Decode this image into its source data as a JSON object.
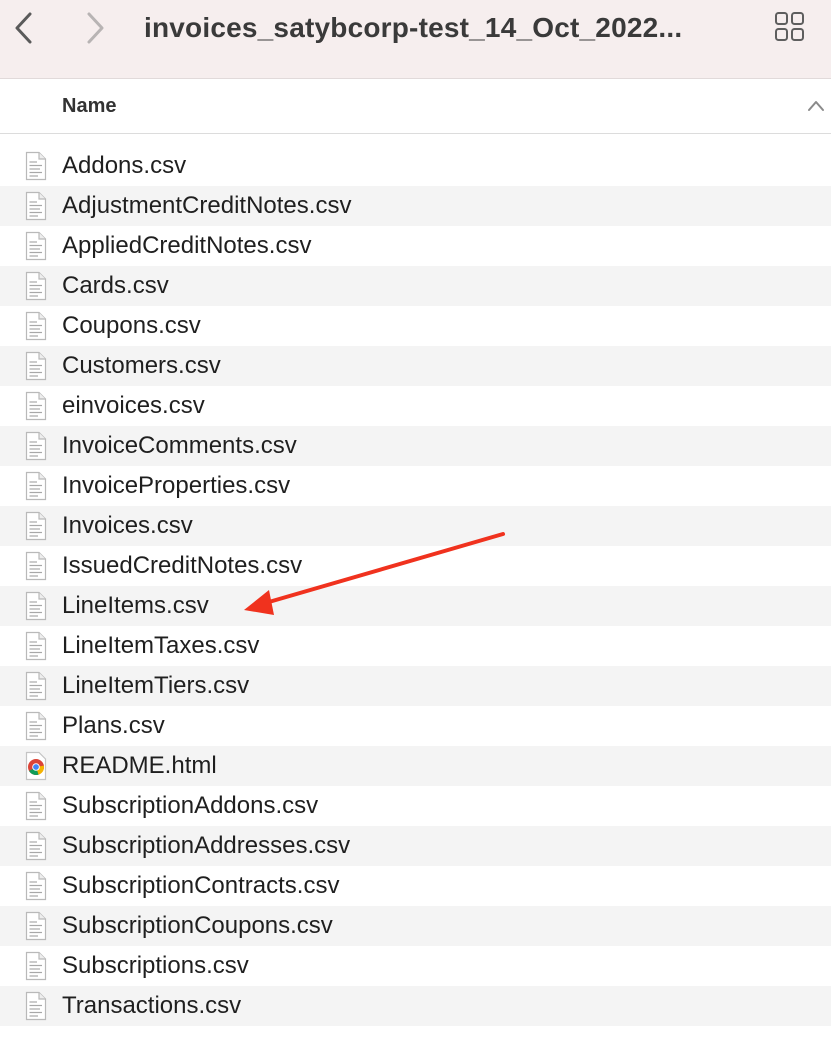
{
  "toolbar": {
    "title": "invoices_satybcorp-test_14_Oct_2022...",
    "back_icon": "chevron-left-icon",
    "forward_icon": "chevron-right-icon",
    "view_icon": "grid-view-icon"
  },
  "columns": {
    "name_label": "Name",
    "sort_icon": "chevron-up-icon"
  },
  "files": [
    {
      "name": "Addons.csv",
      "icon": "document-icon"
    },
    {
      "name": "AdjustmentCreditNotes.csv",
      "icon": "document-icon"
    },
    {
      "name": "AppliedCreditNotes.csv",
      "icon": "document-icon"
    },
    {
      "name": "Cards.csv",
      "icon": "document-icon"
    },
    {
      "name": "Coupons.csv",
      "icon": "document-icon"
    },
    {
      "name": "Customers.csv",
      "icon": "document-icon"
    },
    {
      "name": "einvoices.csv",
      "icon": "document-icon"
    },
    {
      "name": "InvoiceComments.csv",
      "icon": "document-icon"
    },
    {
      "name": "InvoiceProperties.csv",
      "icon": "document-icon"
    },
    {
      "name": "Invoices.csv",
      "icon": "document-icon"
    },
    {
      "name": "IssuedCreditNotes.csv",
      "icon": "document-icon"
    },
    {
      "name": "LineItems.csv",
      "icon": "document-icon"
    },
    {
      "name": "LineItemTaxes.csv",
      "icon": "document-icon"
    },
    {
      "name": "LineItemTiers.csv",
      "icon": "document-icon"
    },
    {
      "name": "Plans.csv",
      "icon": "document-icon"
    },
    {
      "name": "README.html",
      "icon": "chrome-icon"
    },
    {
      "name": "SubscriptionAddons.csv",
      "icon": "document-icon"
    },
    {
      "name": "SubscriptionAddresses.csv",
      "icon": "document-icon"
    },
    {
      "name": "SubscriptionContracts.csv",
      "icon": "document-icon"
    },
    {
      "name": "SubscriptionCoupons.csv",
      "icon": "document-icon"
    },
    {
      "name": "Subscriptions.csv",
      "icon": "document-icon"
    },
    {
      "name": "Transactions.csv",
      "icon": "document-icon"
    }
  ],
  "annotation": {
    "icon": "red-arrow-icon",
    "color": "#f0321e",
    "target_file_index": 11
  },
  "colors": {
    "toolbar_bg": "#f6eeee",
    "stripe_bg": "#f4f4f4",
    "arrow": "#f0321e"
  }
}
